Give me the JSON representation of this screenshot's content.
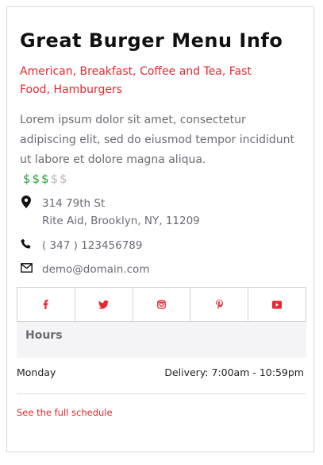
{
  "listing": {
    "title": "Great Burger Menu Info",
    "categories": "American, Breakfast, Coffee and Tea, Fast Food, Hamburgers",
    "description": "Lorem ipsum dolor sit amet, consectetur adipiscing elit, sed do eiusmod tempor incididunt ut labore et dolore magna aliqua.",
    "price_level": {
      "active": "$$$",
      "inactive": "$$",
      "rating": 3,
      "max": 5
    }
  },
  "contact": {
    "address_line1": "314 79th St",
    "address_line2": "Rite Aid, Brooklyn, NY, 11209",
    "phone": "( 347 ) 123456789",
    "email": "demo@domain.com"
  },
  "social": [
    "facebook-icon",
    "twitter-icon",
    "instagram-icon",
    "pinterest-icon",
    "youtube-icon"
  ],
  "hours": {
    "heading": "Hours",
    "day": "Monday",
    "time": "Delivery: 7:00am - 10:59pm",
    "full_schedule_link": "See the full schedule"
  },
  "colors": {
    "accent": "#e8262f",
    "price_active": "#2c9b3c",
    "price_inactive": "#b9b9b9",
    "muted_text": "#6b6b73"
  }
}
